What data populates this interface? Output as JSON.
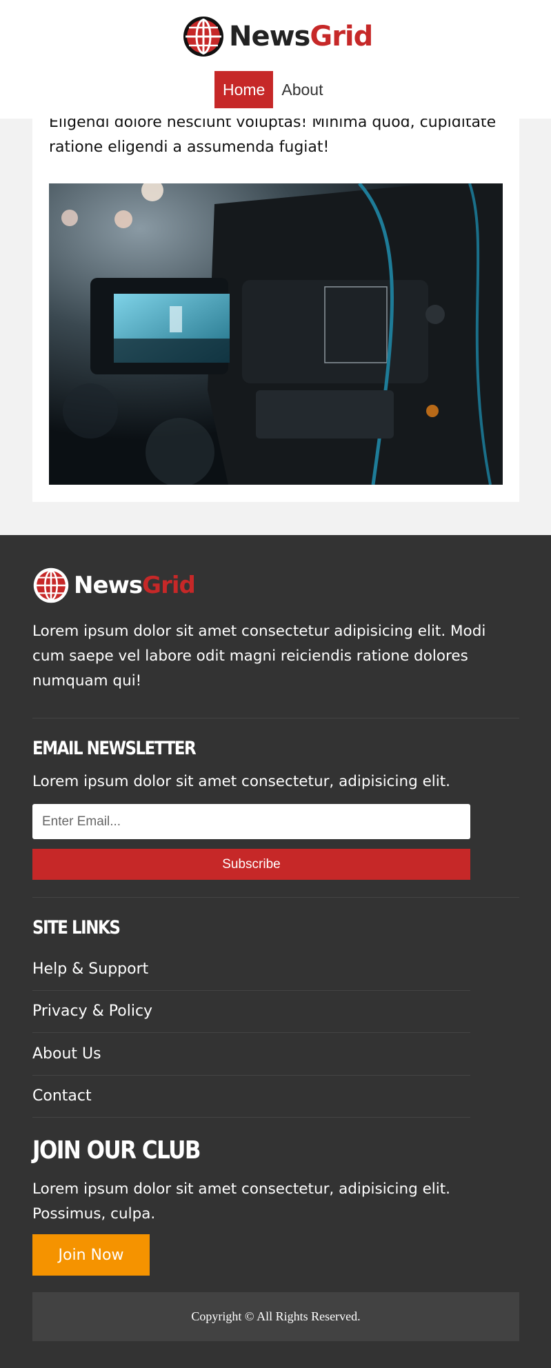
{
  "header": {
    "brand_news": "News",
    "brand_grid": "Grid",
    "nav": [
      {
        "label": "Home",
        "active": true
      },
      {
        "label": "About",
        "active": false
      }
    ]
  },
  "article": {
    "text": "Eligendi dolore nesciunt voluptas! Minima quod, cupiditate ratione eligendi a assumenda fugiat!",
    "image_icon": "video-camera-photo"
  },
  "footer": {
    "brand_news": "News",
    "brand_grid": "Grid",
    "about": "Lorem ipsum dolor sit amet consectetur adipisicing elit. Modi cum saepe vel labore odit magni reiciendis ratione dolores numquam qui!",
    "newsletter": {
      "heading": "Email Newsletter",
      "text": "Lorem ipsum dolor sit amet consectetur, adipisicing elit.",
      "placeholder": "Enter Email...",
      "button": "Subscribe"
    },
    "site_links": {
      "heading": "Site Links",
      "items": [
        "Help & Support",
        "Privacy & Policy",
        "About Us",
        "Contact"
      ]
    },
    "club": {
      "heading": "Join Our Club",
      "text": "Lorem ipsum dolor sit amet consectetur, adipisicing elit. Possimus, culpa.",
      "button": "Join Now"
    },
    "copyright": "Copyright © All Rights Reserved."
  },
  "colors": {
    "brand_red": "#c62828",
    "footer_bg": "#333333",
    "join_orange": "#f59300",
    "page_bg": "#f2f2f2"
  }
}
